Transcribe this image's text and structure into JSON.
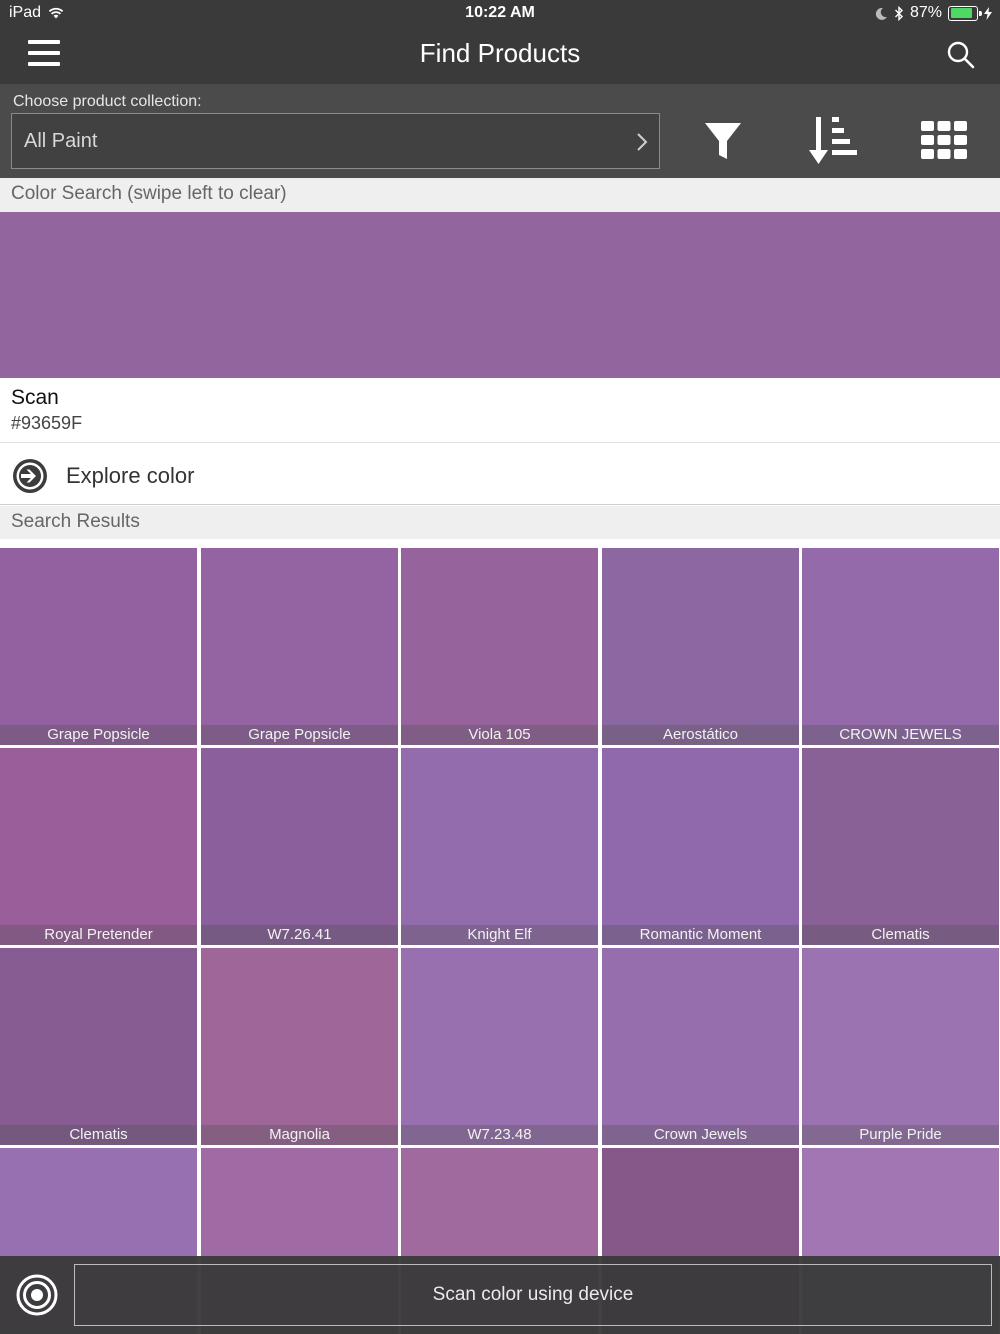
{
  "status_bar": {
    "device": "iPad",
    "time": "10:22 AM",
    "battery_percent": "87%",
    "battery_level": 0.87
  },
  "nav": {
    "title": "Find Products"
  },
  "controls": {
    "collection_label": "Choose product collection:",
    "collection_value": "All Paint"
  },
  "color_search": {
    "header": "Color Search (swipe left to clear)",
    "swatch_color": "#93659F",
    "scan_title": "Scan",
    "scan_hex": "#93659F",
    "explore_label": "Explore color"
  },
  "results": {
    "header": "Search Results",
    "tiles": [
      {
        "name": "Grape Popsicle",
        "color": "#93619f"
      },
      {
        "name": "Grape Popsicle",
        "color": "#9363a2"
      },
      {
        "name": "Viola 105",
        "color": "#96639c"
      },
      {
        "name": "Aerostático",
        "color": "#8c68a0"
      },
      {
        "name": "CROWN JEWELS",
        "color": "#946aab"
      },
      {
        "name": "Royal Pretender",
        "color": "#9a5e9b"
      },
      {
        "name": "W7.26.41",
        "color": "#8a5f9c"
      },
      {
        "name": "Knight Elf",
        "color": "#926cac"
      },
      {
        "name": "Romantic Moment",
        "color": "#8f69ab"
      },
      {
        "name": "Clematis",
        "color": "#8a6197"
      },
      {
        "name": "Clematis",
        "color": "#865c93"
      },
      {
        "name": "Magnolia",
        "color": "#9e6699"
      },
      {
        "name": "W7.23.48",
        "color": "#9870b0"
      },
      {
        "name": "Crown Jewels",
        "color": "#966eae"
      },
      {
        "name": "Purple Pride",
        "color": "#9b73b0"
      },
      {
        "name": "",
        "color": "#9670b0"
      },
      {
        "name": "",
        "color": "#a06ba5"
      },
      {
        "name": "",
        "color": "#a06a9e"
      },
      {
        "name": "",
        "color": "#855889"
      },
      {
        "name": "",
        "color": "#a176b2"
      }
    ]
  },
  "bottom": {
    "scan_button_label": "Scan color using device"
  },
  "icons": {
    "menu": "hamburger-menu-icon",
    "search": "search-icon",
    "filter": "filter-icon",
    "sort": "sort-icon",
    "grid": "grid-view-icon",
    "explore": "arrow-right-circle-icon",
    "scan": "scan-target-icon"
  }
}
